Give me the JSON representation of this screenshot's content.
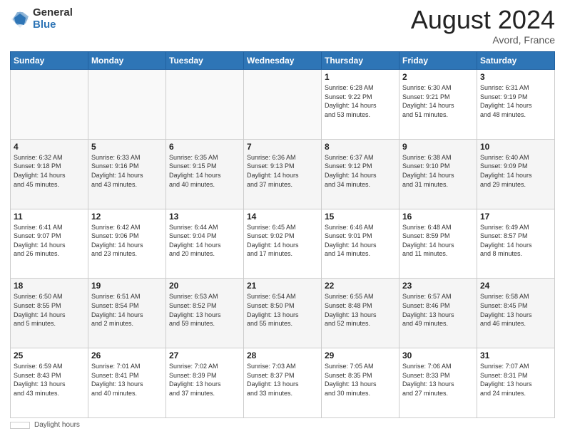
{
  "header": {
    "logo_general": "General",
    "logo_blue": "Blue",
    "month_title": "August 2024",
    "location": "Avord, France"
  },
  "days_of_week": [
    "Sunday",
    "Monday",
    "Tuesday",
    "Wednesday",
    "Thursday",
    "Friday",
    "Saturday"
  ],
  "footer": {
    "label": "Daylight hours"
  },
  "weeks": [
    [
      {
        "day": "",
        "info": ""
      },
      {
        "day": "",
        "info": ""
      },
      {
        "day": "",
        "info": ""
      },
      {
        "day": "",
        "info": ""
      },
      {
        "day": "1",
        "info": "Sunrise: 6:28 AM\nSunset: 9:22 PM\nDaylight: 14 hours\nand 53 minutes."
      },
      {
        "day": "2",
        "info": "Sunrise: 6:30 AM\nSunset: 9:21 PM\nDaylight: 14 hours\nand 51 minutes."
      },
      {
        "day": "3",
        "info": "Sunrise: 6:31 AM\nSunset: 9:19 PM\nDaylight: 14 hours\nand 48 minutes."
      }
    ],
    [
      {
        "day": "4",
        "info": "Sunrise: 6:32 AM\nSunset: 9:18 PM\nDaylight: 14 hours\nand 45 minutes."
      },
      {
        "day": "5",
        "info": "Sunrise: 6:33 AM\nSunset: 9:16 PM\nDaylight: 14 hours\nand 43 minutes."
      },
      {
        "day": "6",
        "info": "Sunrise: 6:35 AM\nSunset: 9:15 PM\nDaylight: 14 hours\nand 40 minutes."
      },
      {
        "day": "7",
        "info": "Sunrise: 6:36 AM\nSunset: 9:13 PM\nDaylight: 14 hours\nand 37 minutes."
      },
      {
        "day": "8",
        "info": "Sunrise: 6:37 AM\nSunset: 9:12 PM\nDaylight: 14 hours\nand 34 minutes."
      },
      {
        "day": "9",
        "info": "Sunrise: 6:38 AM\nSunset: 9:10 PM\nDaylight: 14 hours\nand 31 minutes."
      },
      {
        "day": "10",
        "info": "Sunrise: 6:40 AM\nSunset: 9:09 PM\nDaylight: 14 hours\nand 29 minutes."
      }
    ],
    [
      {
        "day": "11",
        "info": "Sunrise: 6:41 AM\nSunset: 9:07 PM\nDaylight: 14 hours\nand 26 minutes."
      },
      {
        "day": "12",
        "info": "Sunrise: 6:42 AM\nSunset: 9:06 PM\nDaylight: 14 hours\nand 23 minutes."
      },
      {
        "day": "13",
        "info": "Sunrise: 6:44 AM\nSunset: 9:04 PM\nDaylight: 14 hours\nand 20 minutes."
      },
      {
        "day": "14",
        "info": "Sunrise: 6:45 AM\nSunset: 9:02 PM\nDaylight: 14 hours\nand 17 minutes."
      },
      {
        "day": "15",
        "info": "Sunrise: 6:46 AM\nSunset: 9:01 PM\nDaylight: 14 hours\nand 14 minutes."
      },
      {
        "day": "16",
        "info": "Sunrise: 6:48 AM\nSunset: 8:59 PM\nDaylight: 14 hours\nand 11 minutes."
      },
      {
        "day": "17",
        "info": "Sunrise: 6:49 AM\nSunset: 8:57 PM\nDaylight: 14 hours\nand 8 minutes."
      }
    ],
    [
      {
        "day": "18",
        "info": "Sunrise: 6:50 AM\nSunset: 8:55 PM\nDaylight: 14 hours\nand 5 minutes."
      },
      {
        "day": "19",
        "info": "Sunrise: 6:51 AM\nSunset: 8:54 PM\nDaylight: 14 hours\nand 2 minutes."
      },
      {
        "day": "20",
        "info": "Sunrise: 6:53 AM\nSunset: 8:52 PM\nDaylight: 13 hours\nand 59 minutes."
      },
      {
        "day": "21",
        "info": "Sunrise: 6:54 AM\nSunset: 8:50 PM\nDaylight: 13 hours\nand 55 minutes."
      },
      {
        "day": "22",
        "info": "Sunrise: 6:55 AM\nSunset: 8:48 PM\nDaylight: 13 hours\nand 52 minutes."
      },
      {
        "day": "23",
        "info": "Sunrise: 6:57 AM\nSunset: 8:46 PM\nDaylight: 13 hours\nand 49 minutes."
      },
      {
        "day": "24",
        "info": "Sunrise: 6:58 AM\nSunset: 8:45 PM\nDaylight: 13 hours\nand 46 minutes."
      }
    ],
    [
      {
        "day": "25",
        "info": "Sunrise: 6:59 AM\nSunset: 8:43 PM\nDaylight: 13 hours\nand 43 minutes."
      },
      {
        "day": "26",
        "info": "Sunrise: 7:01 AM\nSunset: 8:41 PM\nDaylight: 13 hours\nand 40 minutes."
      },
      {
        "day": "27",
        "info": "Sunrise: 7:02 AM\nSunset: 8:39 PM\nDaylight: 13 hours\nand 37 minutes."
      },
      {
        "day": "28",
        "info": "Sunrise: 7:03 AM\nSunset: 8:37 PM\nDaylight: 13 hours\nand 33 minutes."
      },
      {
        "day": "29",
        "info": "Sunrise: 7:05 AM\nSunset: 8:35 PM\nDaylight: 13 hours\nand 30 minutes."
      },
      {
        "day": "30",
        "info": "Sunrise: 7:06 AM\nSunset: 8:33 PM\nDaylight: 13 hours\nand 27 minutes."
      },
      {
        "day": "31",
        "info": "Sunrise: 7:07 AM\nSunset: 8:31 PM\nDaylight: 13 hours\nand 24 minutes."
      }
    ]
  ]
}
